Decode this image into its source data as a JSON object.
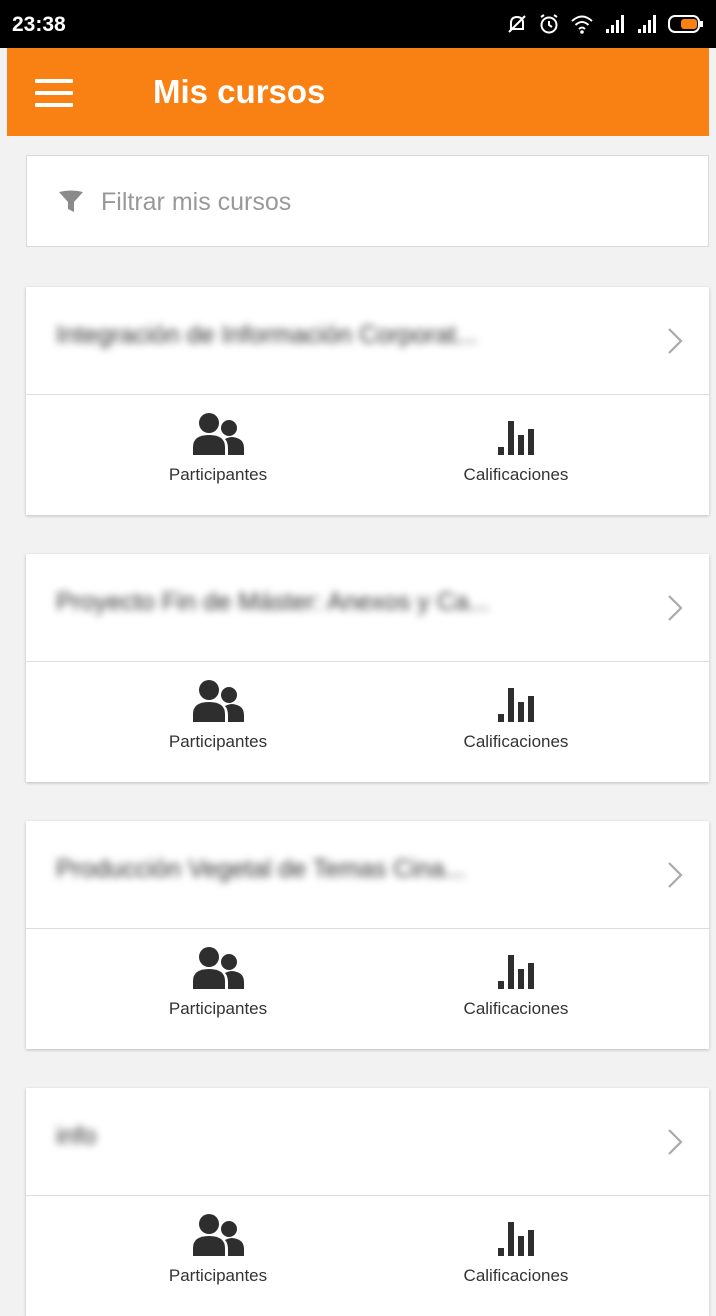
{
  "statusbar": {
    "time": "23:38"
  },
  "appbar": {
    "title": "Mis cursos"
  },
  "search": {
    "placeholder": "Filtrar mis cursos"
  },
  "courses": [
    {
      "name": "Integración de Información Corporat...",
      "participants_label": "Participantes",
      "grades_label": "Calificaciones"
    },
    {
      "name": "Proyecto Fin de Máster: Anexos y Ca...",
      "participants_label": "Participantes",
      "grades_label": "Calificaciones"
    },
    {
      "name": "Producción Vegetal de Temas Cina...",
      "participants_label": "Participantes",
      "grades_label": "Calificaciones"
    },
    {
      "name": "info",
      "participants_label": "Participantes",
      "grades_label": "Calificaciones"
    }
  ],
  "colors": {
    "accent": "#f98012",
    "icon": "#2e2e2e",
    "background": "#f2f2f2"
  }
}
